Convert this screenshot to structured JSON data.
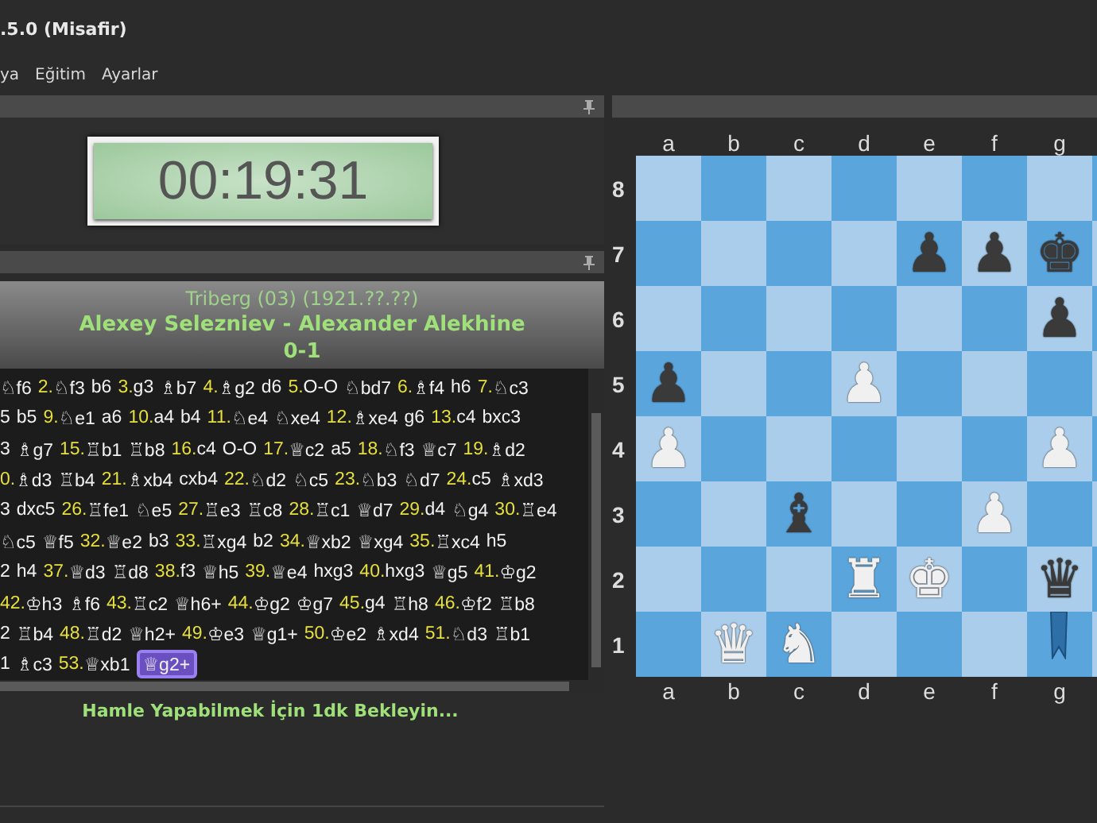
{
  "window": {
    "title": ".5.0 (Misafir)"
  },
  "menu": [
    "ya",
    "Eğitim",
    "Ayarlar"
  ],
  "clock": {
    "time": "00:19:31"
  },
  "game": {
    "event": "Triberg (03) (1921.??.??)",
    "players": "Alexey Selezniev - Alexander Alekhine",
    "result": "0-1"
  },
  "moves": [
    [
      {
        "kind": "move",
        "t": "♘f6"
      },
      {
        "kind": "num",
        "t": "2."
      },
      {
        "kind": "move",
        "t": "♘f3"
      },
      {
        "kind": "move",
        "t": "b6"
      },
      {
        "kind": "num",
        "t": "3."
      },
      {
        "kind": "move",
        "t": "g3"
      },
      {
        "kind": "move",
        "t": "♗b7"
      },
      {
        "kind": "num",
        "t": "4."
      },
      {
        "kind": "move",
        "t": "♗g2"
      },
      {
        "kind": "move",
        "t": "d6"
      },
      {
        "kind": "num",
        "t": "5."
      },
      {
        "kind": "move",
        "t": "O-O"
      },
      {
        "kind": "move",
        "t": "♘bd7"
      },
      {
        "kind": "num",
        "t": "6."
      },
      {
        "kind": "move",
        "t": "♗f4"
      },
      {
        "kind": "move",
        "t": "h6"
      },
      {
        "kind": "num",
        "t": "7."
      },
      {
        "kind": "move",
        "t": "♘c3"
      }
    ],
    [
      {
        "kind": "move",
        "t": "5"
      },
      {
        "kind": "move",
        "t": "b5"
      },
      {
        "kind": "num",
        "t": "9."
      },
      {
        "kind": "move",
        "t": "♘e1"
      },
      {
        "kind": "move",
        "t": "a6"
      },
      {
        "kind": "num",
        "t": "10."
      },
      {
        "kind": "move",
        "t": "a4"
      },
      {
        "kind": "move",
        "t": "b4"
      },
      {
        "kind": "num",
        "t": "11."
      },
      {
        "kind": "move",
        "t": "♘e4"
      },
      {
        "kind": "move",
        "t": "♘xe4"
      },
      {
        "kind": "num",
        "t": "12."
      },
      {
        "kind": "move",
        "t": "♗xe4"
      },
      {
        "kind": "move",
        "t": "g6"
      },
      {
        "kind": "num",
        "t": "13."
      },
      {
        "kind": "move",
        "t": "c4"
      },
      {
        "kind": "move",
        "t": "bxc3"
      }
    ],
    [
      {
        "kind": "move",
        "t": "3"
      },
      {
        "kind": "move",
        "t": "♗g7"
      },
      {
        "kind": "num",
        "t": "15."
      },
      {
        "kind": "move",
        "t": "♖b1"
      },
      {
        "kind": "move",
        "t": "♖b8"
      },
      {
        "kind": "num",
        "t": "16."
      },
      {
        "kind": "move",
        "t": "c4"
      },
      {
        "kind": "move",
        "t": "O-O"
      },
      {
        "kind": "num",
        "t": "17."
      },
      {
        "kind": "move",
        "t": "♕c2"
      },
      {
        "kind": "move",
        "t": "a5"
      },
      {
        "kind": "num",
        "t": "18."
      },
      {
        "kind": "move",
        "t": "♘f3"
      },
      {
        "kind": "move",
        "t": "♕c7"
      },
      {
        "kind": "num",
        "t": "19."
      },
      {
        "kind": "move",
        "t": "♗d2"
      }
    ],
    [
      {
        "kind": "num",
        "t": "0."
      },
      {
        "kind": "move",
        "t": "♗d3"
      },
      {
        "kind": "move",
        "t": "♖b4"
      },
      {
        "kind": "num",
        "t": "21."
      },
      {
        "kind": "move",
        "t": "♗xb4"
      },
      {
        "kind": "move",
        "t": "cxb4"
      },
      {
        "kind": "num",
        "t": "22."
      },
      {
        "kind": "move",
        "t": "♘d2"
      },
      {
        "kind": "move",
        "t": "♘c5"
      },
      {
        "kind": "num",
        "t": "23."
      },
      {
        "kind": "move",
        "t": "♘b3"
      },
      {
        "kind": "move",
        "t": "♘d7"
      },
      {
        "kind": "num",
        "t": "24."
      },
      {
        "kind": "move",
        "t": "c5"
      },
      {
        "kind": "move",
        "t": "♗xd3"
      }
    ],
    [
      {
        "kind": "move",
        "t": "3"
      },
      {
        "kind": "move",
        "t": "dxc5"
      },
      {
        "kind": "num",
        "t": "26."
      },
      {
        "kind": "move",
        "t": "♖fe1"
      },
      {
        "kind": "move",
        "t": "♘e5"
      },
      {
        "kind": "num",
        "t": "27."
      },
      {
        "kind": "move",
        "t": "♖e3"
      },
      {
        "kind": "move",
        "t": "♖c8"
      },
      {
        "kind": "num",
        "t": "28."
      },
      {
        "kind": "move",
        "t": "♖c1"
      },
      {
        "kind": "move",
        "t": "♕d7"
      },
      {
        "kind": "num",
        "t": "29."
      },
      {
        "kind": "move",
        "t": "d4"
      },
      {
        "kind": "move",
        "t": "♘g4"
      },
      {
        "kind": "num",
        "t": "30."
      },
      {
        "kind": "move",
        "t": "♖e4"
      }
    ],
    [
      {
        "kind": "move",
        "t": "♘c5"
      },
      {
        "kind": "move",
        "t": "♕f5"
      },
      {
        "kind": "num",
        "t": "32."
      },
      {
        "kind": "move",
        "t": "♕e2"
      },
      {
        "kind": "move",
        "t": "b3"
      },
      {
        "kind": "num",
        "t": "33."
      },
      {
        "kind": "move",
        "t": "♖xg4"
      },
      {
        "kind": "move",
        "t": "b2"
      },
      {
        "kind": "num",
        "t": "34."
      },
      {
        "kind": "move",
        "t": "♕xb2"
      },
      {
        "kind": "move",
        "t": "♕xg4"
      },
      {
        "kind": "num",
        "t": "35."
      },
      {
        "kind": "move",
        "t": "♖xc4"
      },
      {
        "kind": "move",
        "t": "h5"
      }
    ],
    [
      {
        "kind": "move",
        "t": "2"
      },
      {
        "kind": "move",
        "t": "h4"
      },
      {
        "kind": "num",
        "t": "37."
      },
      {
        "kind": "move",
        "t": "♕d3"
      },
      {
        "kind": "move",
        "t": "♖d8"
      },
      {
        "kind": "num",
        "t": "38."
      },
      {
        "kind": "move",
        "t": "f3"
      },
      {
        "kind": "move",
        "t": "♕h5"
      },
      {
        "kind": "num",
        "t": "39."
      },
      {
        "kind": "move",
        "t": "♕e4"
      },
      {
        "kind": "move",
        "t": "hxg3"
      },
      {
        "kind": "num",
        "t": "40."
      },
      {
        "kind": "move",
        "t": "hxg3"
      },
      {
        "kind": "move",
        "t": "♕g5"
      },
      {
        "kind": "num",
        "t": "41."
      },
      {
        "kind": "move",
        "t": "♔g2"
      }
    ],
    [
      {
        "kind": "num",
        "t": "42."
      },
      {
        "kind": "move",
        "t": "♔h3"
      },
      {
        "kind": "move",
        "t": "♗f6"
      },
      {
        "kind": "num",
        "t": "43."
      },
      {
        "kind": "move",
        "t": "♖c2"
      },
      {
        "kind": "move",
        "t": "♕h6+"
      },
      {
        "kind": "num",
        "t": "44."
      },
      {
        "kind": "move",
        "t": "♔g2"
      },
      {
        "kind": "move",
        "t": "♔g7"
      },
      {
        "kind": "num",
        "t": "45."
      },
      {
        "kind": "move",
        "t": "g4"
      },
      {
        "kind": "move",
        "t": "♖h8"
      },
      {
        "kind": "num",
        "t": "46."
      },
      {
        "kind": "move",
        "t": "♔f2"
      },
      {
        "kind": "move",
        "t": "♖b8"
      }
    ],
    [
      {
        "kind": "move",
        "t": "2"
      },
      {
        "kind": "move",
        "t": "♖b4"
      },
      {
        "kind": "num",
        "t": "48."
      },
      {
        "kind": "move",
        "t": "♖d2"
      },
      {
        "kind": "move",
        "t": "♕h2+"
      },
      {
        "kind": "num",
        "t": "49."
      },
      {
        "kind": "move",
        "t": "♔e3"
      },
      {
        "kind": "move",
        "t": "♕g1+"
      },
      {
        "kind": "num",
        "t": "50."
      },
      {
        "kind": "move",
        "t": "♔e2"
      },
      {
        "kind": "move",
        "t": "♗xd4"
      },
      {
        "kind": "num",
        "t": "51."
      },
      {
        "kind": "move",
        "t": "♘d3"
      },
      {
        "kind": "move",
        "t": "♖b1"
      }
    ],
    [
      {
        "kind": "move",
        "t": "1"
      },
      {
        "kind": "move",
        "t": "♗c3"
      },
      {
        "kind": "num",
        "t": "53."
      },
      {
        "kind": "move",
        "t": "♕xb1"
      },
      {
        "kind": "current",
        "t": "♕g2+"
      }
    ]
  ],
  "status": "Hamle Yapabilmek İçin 1dk Bekleyin...",
  "board": {
    "top_files": [
      "a",
      "b",
      "c",
      "d",
      "e",
      "f",
      "g"
    ],
    "bottom_files": [
      "a",
      "b",
      "c",
      "d",
      "e",
      "f",
      "g"
    ],
    "ranks": [
      "8",
      "7",
      "6",
      "5",
      "4",
      "3",
      "2",
      "1"
    ],
    "rows": [
      [
        {
          "kind": "empty"
        },
        {
          "kind": "empty"
        },
        {
          "kind": "empty"
        },
        {
          "kind": "empty"
        },
        {
          "kind": "empty"
        },
        {
          "kind": "empty"
        },
        {
          "kind": "empty"
        },
        {
          "kind": "empty"
        }
      ],
      [
        {
          "kind": "empty"
        },
        {
          "kind": "empty"
        },
        {
          "kind": "empty"
        },
        {
          "kind": "empty"
        },
        {
          "kind": "black",
          "glyph": "♟"
        },
        {
          "kind": "black",
          "glyph": "♟"
        },
        {
          "kind": "black",
          "glyph": "♚"
        },
        {
          "kind": "empty"
        }
      ],
      [
        {
          "kind": "empty"
        },
        {
          "kind": "empty"
        },
        {
          "kind": "empty"
        },
        {
          "kind": "empty"
        },
        {
          "kind": "empty"
        },
        {
          "kind": "empty"
        },
        {
          "kind": "black",
          "glyph": "♟"
        },
        {
          "kind": "empty"
        }
      ],
      [
        {
          "kind": "black",
          "glyph": "♟"
        },
        {
          "kind": "empty"
        },
        {
          "kind": "empty"
        },
        {
          "kind": "white",
          "glyph": "♟"
        },
        {
          "kind": "empty"
        },
        {
          "kind": "empty"
        },
        {
          "kind": "empty"
        },
        {
          "kind": "empty"
        }
      ],
      [
        {
          "kind": "white",
          "glyph": "♟"
        },
        {
          "kind": "empty"
        },
        {
          "kind": "empty"
        },
        {
          "kind": "empty"
        },
        {
          "kind": "empty"
        },
        {
          "kind": "empty"
        },
        {
          "kind": "white",
          "glyph": "♟"
        },
        {
          "kind": "empty"
        }
      ],
      [
        {
          "kind": "empty"
        },
        {
          "kind": "empty"
        },
        {
          "kind": "black",
          "glyph": "♝"
        },
        {
          "kind": "empty"
        },
        {
          "kind": "empty"
        },
        {
          "kind": "white",
          "glyph": "♟"
        },
        {
          "kind": "empty"
        },
        {
          "kind": "empty"
        }
      ],
      [
        {
          "kind": "empty"
        },
        {
          "kind": "empty"
        },
        {
          "kind": "empty"
        },
        {
          "kind": "white",
          "glyph": "♜"
        },
        {
          "kind": "white",
          "glyph": "♚"
        },
        {
          "kind": "empty"
        },
        {
          "kind": "black",
          "glyph": "♛"
        },
        {
          "kind": "empty"
        }
      ],
      [
        {
          "kind": "empty"
        },
        {
          "kind": "white",
          "glyph": "♛"
        },
        {
          "kind": "white",
          "glyph": "♞"
        },
        {
          "kind": "empty"
        },
        {
          "kind": "empty"
        },
        {
          "kind": "empty"
        },
        {
          "kind": "marker"
        },
        {
          "kind": "empty"
        }
      ]
    ]
  }
}
